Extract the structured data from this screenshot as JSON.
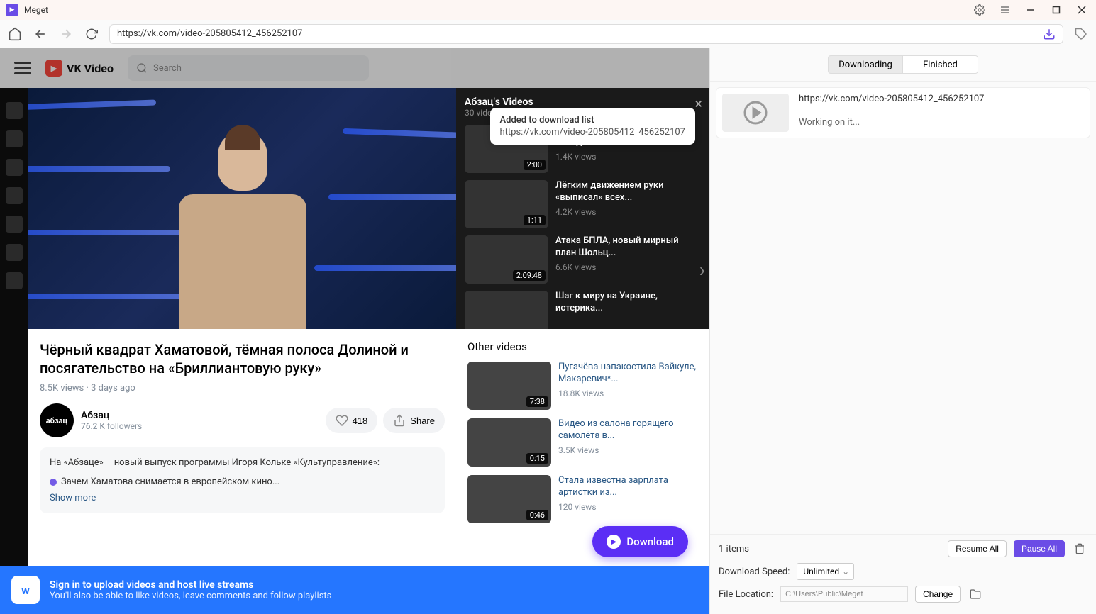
{
  "app": {
    "name": "Meget"
  },
  "toolbar": {
    "url": "https://vk.com/video-205805412_456252107"
  },
  "vk": {
    "logo_text": "VK Video",
    "search_placeholder": "Search"
  },
  "toast": {
    "title": "Added to download list",
    "url": "https://vk.com/video-205805412_456252107"
  },
  "playlist": {
    "title": "Абзац's Videos",
    "count": "30 videos",
    "items": [
      {
        "title": "Политолог раскрыл позицию Запада",
        "views": "1.4K views",
        "duration": "2:00"
      },
      {
        "title": "Лёгким движением руки «выписал» всех...",
        "views": "4.2K views",
        "duration": "1:11"
      },
      {
        "title": "Атака БПЛА, новый мирный план Шольц...",
        "views": "6.6K views",
        "duration": "2:09:48"
      },
      {
        "title": "Шаг к миру на Украине, истерика...",
        "views": "",
        "duration": ""
      }
    ]
  },
  "video": {
    "title": "Чёрный квадрат Хаматовой, тёмная полоса Долиной и посягательство на «Бриллиантовую руку»",
    "stats": "8.5K views  ·  3 days ago",
    "channel_name": "Абзац",
    "channel_avatar_text": "абзац",
    "channel_followers": "76.2 K followers",
    "like_count": "418",
    "share_label": "Share",
    "desc_line1": "На «Абзаце» – новый выпуск программы Игоря Кольке «Культуправление»:",
    "desc_line2": "Зачем Хаматова снимается в европейском кино...",
    "show_more": "Show more"
  },
  "other": {
    "title": "Other videos",
    "items": [
      {
        "title": "Пугачёва напакостила Вайкуле, Макаревич*...",
        "views": "18.8K views",
        "duration": "7:38"
      },
      {
        "title": "Видео из салона горящего самолёта в...",
        "views": "3.5K views",
        "duration": "0:15"
      },
      {
        "title": "Стала известна зарплата артистки из...",
        "views": "120 views",
        "duration": "0:46"
      }
    ]
  },
  "signin": {
    "line1": "Sign in to upload videos and host live streams",
    "line2": "You'll also be able to like videos, leave comments and follow playlists"
  },
  "download_button": "Download",
  "downloads": {
    "tabs": {
      "downloading": "Downloading",
      "finished": "Finished"
    },
    "item": {
      "url": "https://vk.com/video-205805412_456252107",
      "status": "Working on it..."
    },
    "footer": {
      "items_count": "1 items",
      "resume_all": "Resume All",
      "pause_all": "Pause All",
      "speed_label": "Download Speed:",
      "speed_value": "Unlimited",
      "location_label": "File Location:",
      "location_value": "C:\\Users\\Public\\Meget",
      "change": "Change"
    }
  }
}
